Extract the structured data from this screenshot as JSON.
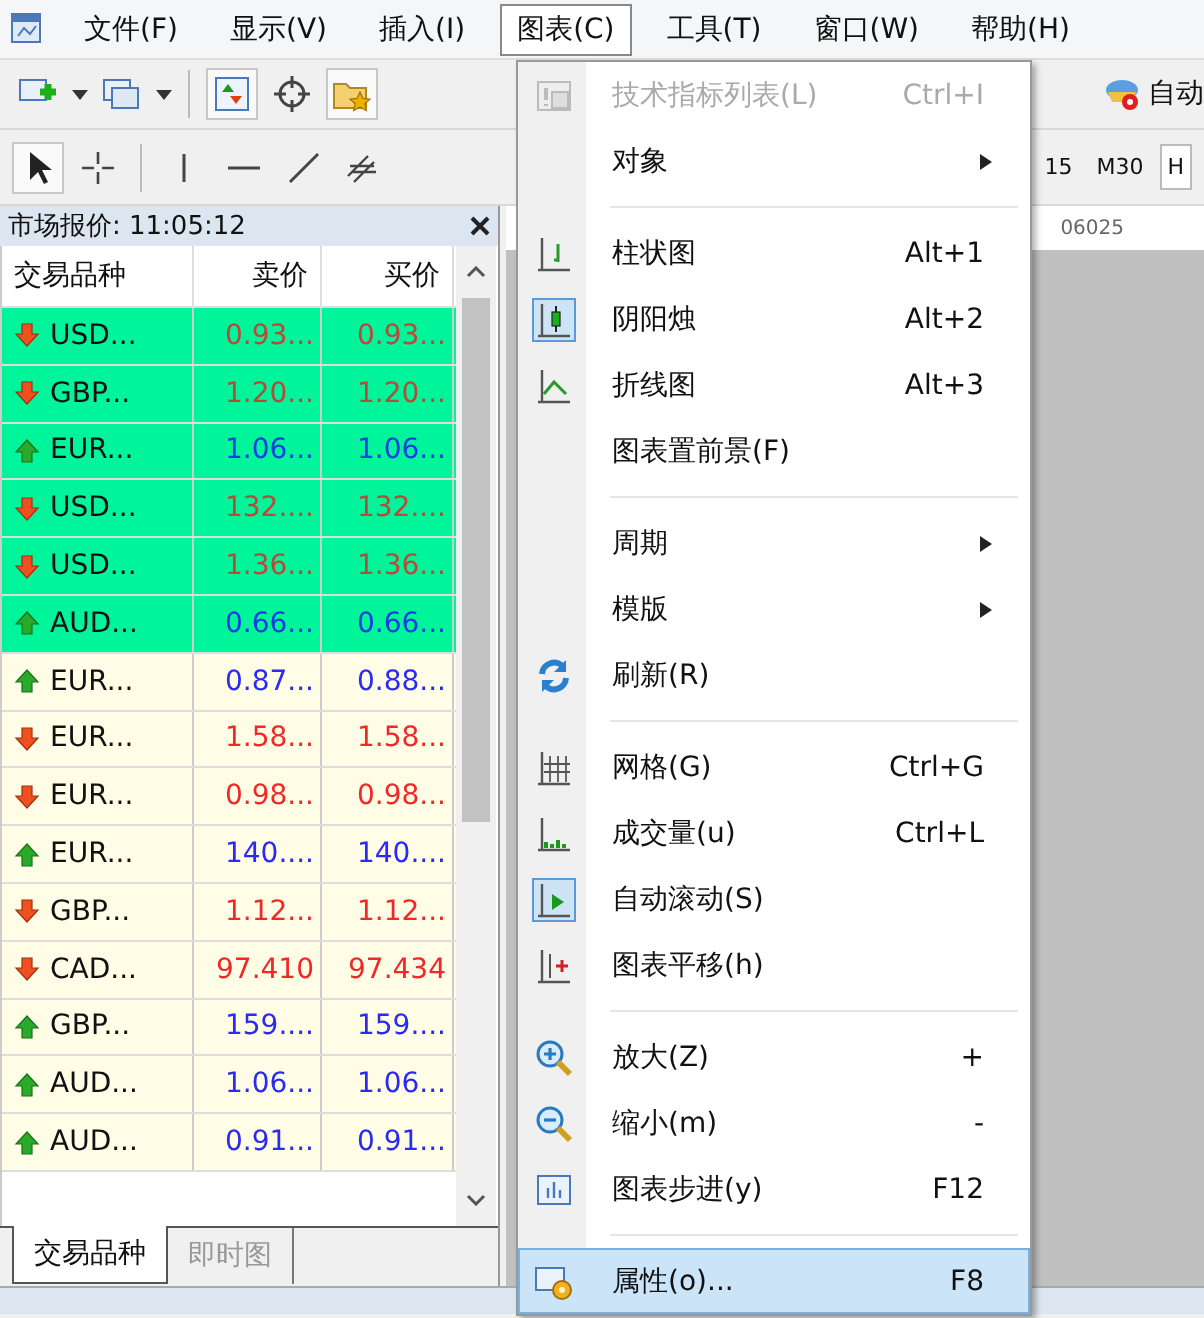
{
  "menubar": {
    "items": [
      {
        "label": "文件(F)",
        "selected": false
      },
      {
        "label": "显示(V)",
        "selected": false
      },
      {
        "label": "插入(I)",
        "selected": false
      },
      {
        "label": "图表(C)",
        "selected": true
      },
      {
        "label": "工具(T)",
        "selected": false
      },
      {
        "label": "窗口(W)",
        "selected": false
      },
      {
        "label": "帮助(H)",
        "selected": false
      }
    ]
  },
  "toolbar": {
    "autotrade_label": "自动",
    "timeframes": [
      "15",
      "M30",
      "H"
    ]
  },
  "chart_menu": {
    "items": [
      {
        "kind": "item",
        "label": "技术指标列表(L)",
        "shortcut": "Ctrl+I",
        "disabled": true,
        "checked": false,
        "submenu": false,
        "selected": false
      },
      {
        "kind": "item",
        "label": "对象",
        "disabled": false,
        "checked": false,
        "submenu": true,
        "selected": false
      },
      {
        "kind": "separator"
      },
      {
        "kind": "item",
        "label": "柱状图",
        "shortcut": "Alt+1",
        "disabled": false,
        "checked": false,
        "submenu": false,
        "selected": false
      },
      {
        "kind": "item",
        "label": "阴阳烛",
        "shortcut": "Alt+2",
        "disabled": false,
        "checked": true,
        "submenu": false,
        "selected": false
      },
      {
        "kind": "item",
        "label": "折线图",
        "shortcut": "Alt+3",
        "disabled": false,
        "checked": false,
        "submenu": false,
        "selected": false
      },
      {
        "kind": "item",
        "label": "图表置前景(F)",
        "disabled": false,
        "checked": false,
        "submenu": false,
        "selected": false
      },
      {
        "kind": "separator"
      },
      {
        "kind": "item",
        "label": "周期",
        "disabled": false,
        "checked": false,
        "submenu": true,
        "selected": false
      },
      {
        "kind": "item",
        "label": "模版",
        "disabled": false,
        "checked": false,
        "submenu": true,
        "selected": false
      },
      {
        "kind": "item",
        "label": "刷新(R)",
        "disabled": false,
        "checked": false,
        "submenu": false,
        "selected": false
      },
      {
        "kind": "separator"
      },
      {
        "kind": "item",
        "label": "网格(G)",
        "shortcut": "Ctrl+G",
        "disabled": false,
        "checked": false,
        "submenu": false,
        "selected": false
      },
      {
        "kind": "item",
        "label": "成交量(u)",
        "shortcut": "Ctrl+L",
        "disabled": false,
        "checked": false,
        "submenu": false,
        "selected": false
      },
      {
        "kind": "item",
        "label": "自动滚动(S)",
        "disabled": false,
        "checked": true,
        "submenu": false,
        "selected": false
      },
      {
        "kind": "item",
        "label": "图表平移(h)",
        "disabled": false,
        "checked": false,
        "submenu": false,
        "selected": false
      },
      {
        "kind": "separator"
      },
      {
        "kind": "item",
        "label": "放大(Z)",
        "shortcut": "+",
        "disabled": false,
        "checked": false,
        "submenu": false,
        "selected": false
      },
      {
        "kind": "item",
        "label": "缩小(m)",
        "shortcut": "-",
        "disabled": false,
        "checked": false,
        "submenu": false,
        "selected": false
      },
      {
        "kind": "item",
        "label": "图表步进(y)",
        "shortcut": "F12",
        "disabled": false,
        "checked": false,
        "submenu": false,
        "selected": false
      },
      {
        "kind": "separator"
      },
      {
        "kind": "item",
        "label": "属性(o)...",
        "shortcut": "F8",
        "disabled": false,
        "checked": false,
        "submenu": false,
        "selected": true
      }
    ]
  },
  "market_watch": {
    "title": "市场报价: 11:05:12",
    "columns": [
      "交易品种",
      "卖价",
      "买价"
    ],
    "rows": [
      {
        "symbol": "USD...",
        "bid": "0.93...",
        "ask": "0.93...",
        "rising": false,
        "highlighted": true
      },
      {
        "symbol": "GBP...",
        "bid": "1.20...",
        "ask": "1.20...",
        "rising": false,
        "highlighted": true
      },
      {
        "symbol": "EUR...",
        "bid": "1.06...",
        "ask": "1.06...",
        "rising": true,
        "highlighted": true
      },
      {
        "symbol": "USD...",
        "bid": "132....",
        "ask": "132....",
        "rising": false,
        "highlighted": true
      },
      {
        "symbol": "USD...",
        "bid": "1.36...",
        "ask": "1.36...",
        "rising": false,
        "highlighted": true
      },
      {
        "symbol": "AUD...",
        "bid": "0.66...",
        "ask": "0.66...",
        "rising": true,
        "highlighted": true
      },
      {
        "symbol": "EUR...",
        "bid": "0.87...",
        "ask": "0.88...",
        "rising": true,
        "highlighted": false
      },
      {
        "symbol": "EUR...",
        "bid": "1.58...",
        "ask": "1.58...",
        "rising": false,
        "highlighted": false
      },
      {
        "symbol": "EUR...",
        "bid": "0.98...",
        "ask": "0.98...",
        "rising": false,
        "highlighted": false
      },
      {
        "symbol": "EUR...",
        "bid": "140....",
        "ask": "140....",
        "rising": true,
        "highlighted": false
      },
      {
        "symbol": "GBP...",
        "bid": "1.12...",
        "ask": "1.12...",
        "rising": false,
        "highlighted": false
      },
      {
        "symbol": "CAD...",
        "bid": "97.410",
        "ask": "97.434",
        "rising": false,
        "highlighted": false
      },
      {
        "symbol": "GBP...",
        "bid": "159....",
        "ask": "159....",
        "rising": true,
        "highlighted": false
      },
      {
        "symbol": "AUD...",
        "bid": "1.06...",
        "ask": "1.06...",
        "rising": true,
        "highlighted": false
      },
      {
        "symbol": "AUD...",
        "bid": "0.91...",
        "ask": "0.91...",
        "rising": true,
        "highlighted": false
      }
    ],
    "tabs": [
      {
        "label": "交易品种",
        "selected": true
      },
      {
        "label": "即时图",
        "selected": false
      }
    ]
  },
  "chart": {
    "price_label": "06025"
  }
}
